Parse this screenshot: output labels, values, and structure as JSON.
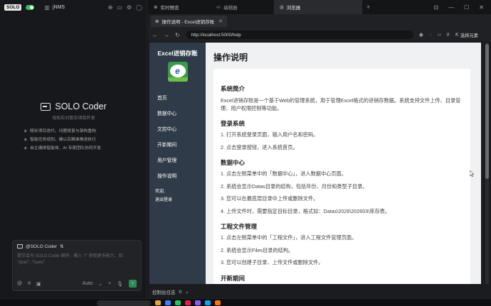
{
  "solo_panel": {
    "badge": "SOLO",
    "project": "jNMS",
    "title": "SOLO Coder",
    "subtitle": "轻松应对复杂项目开发",
    "features": [
      "随长项目迭代、问题修复与架构重构",
      "智能任务规划，确认后精准推进执行",
      "自主编排智能体、AI 专家团队协同开发"
    ],
    "chat": {
      "mention": "@SOLO Coder",
      "placeholder": "提示会与 SOLO Coder 聊天 · 输入 \"/\" 获取更多能力，如 \"/plan\", \"/spec\"",
      "mode": "Auto"
    }
  },
  "browser": {
    "panel_tabs": [
      {
        "label": "实时预览"
      },
      {
        "label": "编辑器"
      },
      {
        "label": "浏览器"
      }
    ],
    "page_tab": "操作说明 - Excel进销存账",
    "url": "http://localhost:5000/help",
    "select_element": "选择元素",
    "console_label": "控制台日志",
    "console_count": "0"
  },
  "page": {
    "brand": "Excel进销存账",
    "nav": [
      "首页",
      "数据中心",
      "文控中心",
      "开新期间",
      "用户管理",
      "操作说明"
    ],
    "user_greeting": "欢迎,",
    "logout": "退出登录",
    "title": "操作说明",
    "sections": [
      {
        "heading": "系统简介",
        "paragraph": "Excel进销存账是一个基于Web的管理系统，用于管理Excel格式的进销存数据。系统支持文件上传、目录管理、用户权限控制等功能。"
      },
      {
        "heading": "登录系统",
        "items": [
          "1. 打开系统登录页面，输入用户名和密码。",
          "2. 点击登录按钮，进入系统首页。"
        ]
      },
      {
        "heading": "数据中心",
        "items": [
          "1. 点击左侧菜单中的「数据中心」，进入数据中心页面。",
          "2. 系统会显示Datas目录的结构，包括年份、月份和类型子目录。",
          "3. 您可以在最底层目录中上传或删除文件。",
          "4. 上传文件时，需要指定目标目录，格式如：Datas\\2026\\202603\\库存表。"
        ]
      },
      {
        "heading": "工程文件管理",
        "items": [
          "1. 点击左侧菜单中的「工程文件」，进入工程文件管理页面。",
          "2. 系统会显示Files目录的结构。",
          "3. 您可以创建子目录、上传文件或删除文件。"
        ]
      },
      {
        "heading": "开新期间",
        "items": []
      }
    ]
  },
  "colors": {
    "sidebar_bg": "#2f3b48",
    "accent_green": "#2fbf5f"
  }
}
